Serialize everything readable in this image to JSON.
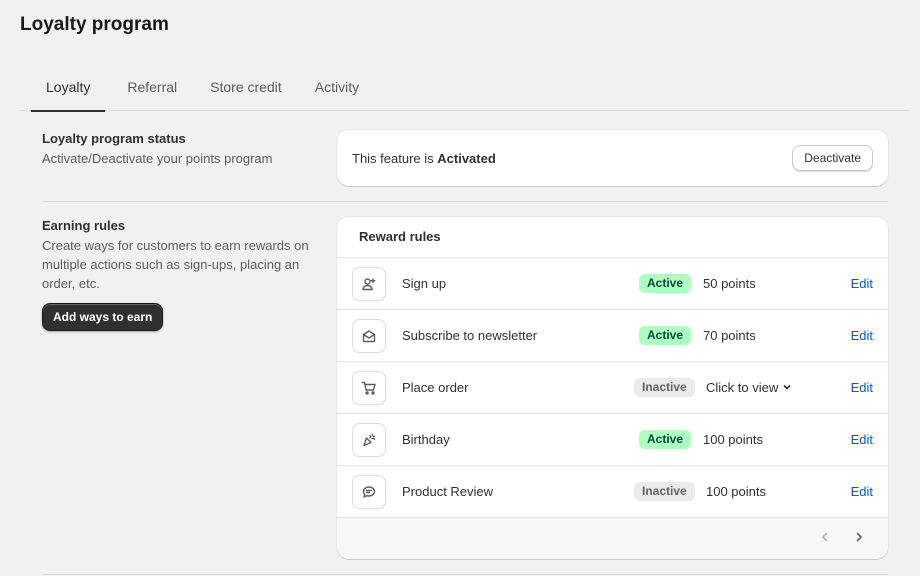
{
  "page": {
    "title": "Loyalty program"
  },
  "tabs": [
    {
      "label": "Loyalty",
      "active": true
    },
    {
      "label": "Referral",
      "active": false
    },
    {
      "label": "Store credit",
      "active": false
    },
    {
      "label": "Activity",
      "active": false
    }
  ],
  "status_section": {
    "heading": "Loyalty program status",
    "description": "Activate/Deactivate your points program",
    "feature_prefix": "This feature is ",
    "feature_state": "Activated",
    "deactivate_label": "Deactivate"
  },
  "earning_section": {
    "heading": "Earning rules",
    "description": "Create ways for customers to earn rewards on multiple actions such as sign-ups, placing an order, etc.",
    "add_button_label": "Add ways to earn"
  },
  "reward_rules": {
    "title": "Reward rules",
    "edit_label": "Edit",
    "rows": [
      {
        "icon": "person-add-icon",
        "name": "Sign up",
        "status": "Active",
        "value": "50 points"
      },
      {
        "icon": "envelope-icon",
        "name": "Subscribe to newsletter",
        "status": "Active",
        "value": "70 points"
      },
      {
        "icon": "cart-icon",
        "name": "Place order",
        "status": "Inactive",
        "value": "Click to view"
      },
      {
        "icon": "confetti-icon",
        "name": "Birthday",
        "status": "Active",
        "value": "100 points"
      },
      {
        "icon": "chat-bubble-icon",
        "name": "Product Review",
        "status": "Inactive",
        "value": "100 points"
      }
    ]
  },
  "colors": {
    "active_badge_bg": "#affebf",
    "inactive_badge_bg": "#ebebeb",
    "link": "#005bd3",
    "primary_button": "#303030"
  }
}
